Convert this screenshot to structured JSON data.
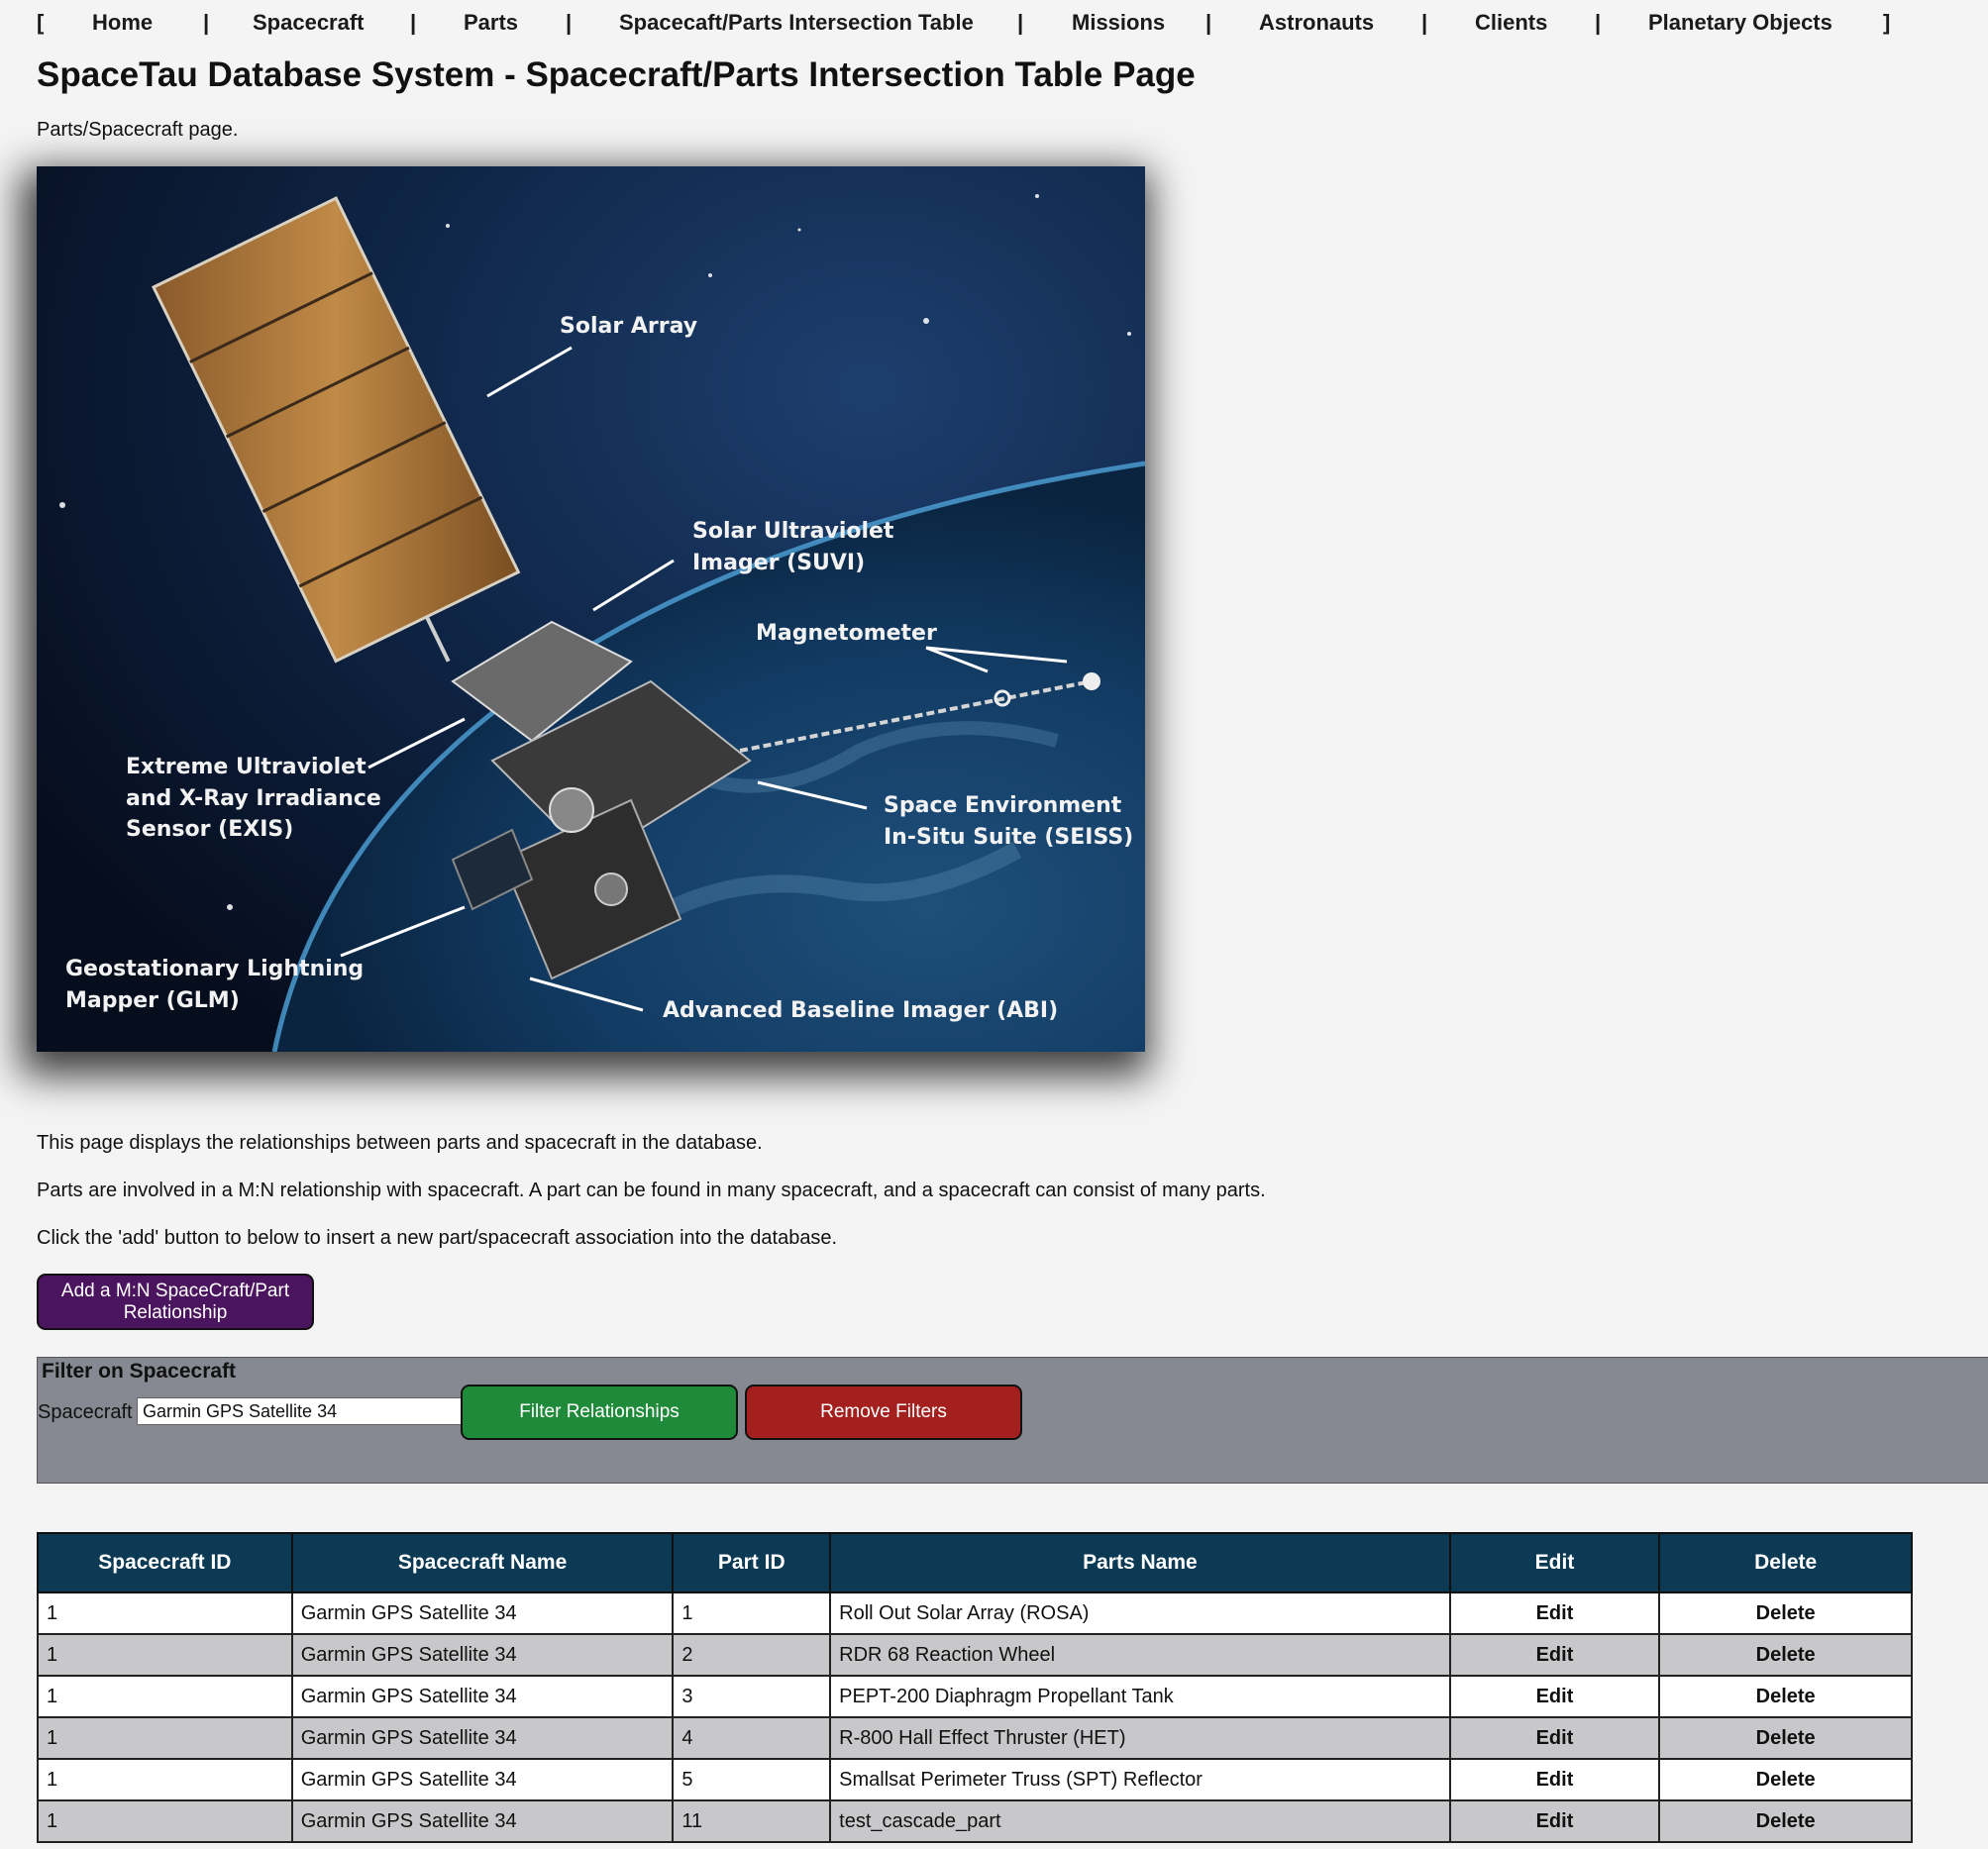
{
  "nav": {
    "bracket_open": "[",
    "bracket_close": "]",
    "separator": "|",
    "links": [
      "Home",
      "Spacecraft",
      "Parts",
      "Spacecaft/Parts Intersection Table",
      "Missions",
      "Astronauts",
      "Clients",
      "Planetary Objects"
    ]
  },
  "page": {
    "title": "SpaceTau Database System - Spacecraft/Parts Intersection Table Page",
    "subtitle": "Parts/Spacecraft page.",
    "para1": "This page displays the relationships between parts and spacecraft in the database.",
    "para2": "Parts are involved in a M:N relationship with spacecraft. A part can be found in many spacecraft, and a spacecraft can consist of many parts.",
    "para3": "Click the 'add' button to below to insert a new part/spacecraft association into the database."
  },
  "image": {
    "labels": {
      "solar_array": "Solar Array",
      "suvi_1": "Solar Ultraviolet",
      "suvi_2": "Imager  (SUVI)",
      "magnetometer": "Magnetometer",
      "exis_1": "Extreme Ultraviolet",
      "exis_2": "and X-Ray Irradiance",
      "exis_3": "Sensor (EXIS)",
      "seiss_1": "Space Environment",
      "seiss_2": "In-Situ Suite  (SEISS)",
      "glm_1": "Geostationary Lightning",
      "glm_2": "Mapper (GLM)",
      "abi": "Advanced Baseline Imager (ABI)"
    }
  },
  "add_button": "Add a M:N SpaceCraft/Part Relationship",
  "filter": {
    "legend": "Filter on Spacecraft",
    "label": "Spacecraft",
    "selected": "Garmin GPS Satellite 34",
    "filter_button": "Filter Relationships",
    "remove_button": "Remove Filters"
  },
  "table": {
    "headers": [
      "Spacecraft ID",
      "Spacecraft Name",
      "Part ID",
      "Parts Name",
      "Edit",
      "Delete"
    ],
    "rows": [
      {
        "sc_id": "1",
        "sc_name": "Garmin GPS Satellite 34",
        "part_id": "1",
        "part_name": "Roll Out Solar Array (ROSA)",
        "edit": "Edit",
        "delete": "Delete"
      },
      {
        "sc_id": "1",
        "sc_name": "Garmin GPS Satellite 34",
        "part_id": "2",
        "part_name": "RDR 68 Reaction Wheel",
        "edit": "Edit",
        "delete": "Delete"
      },
      {
        "sc_id": "1",
        "sc_name": "Garmin GPS Satellite 34",
        "part_id": "3",
        "part_name": "PEPT-200 Diaphragm Propellant Tank",
        "edit": "Edit",
        "delete": "Delete"
      },
      {
        "sc_id": "1",
        "sc_name": "Garmin GPS Satellite 34",
        "part_id": "4",
        "part_name": "R-800 Hall Effect Thruster (HET)",
        "edit": "Edit",
        "delete": "Delete"
      },
      {
        "sc_id": "1",
        "sc_name": "Garmin GPS Satellite 34",
        "part_id": "5",
        "part_name": "Smallsat Perimeter Truss (SPT) Reflector",
        "edit": "Edit",
        "delete": "Delete"
      },
      {
        "sc_id": "1",
        "sc_name": "Garmin GPS Satellite 34",
        "part_id": "11",
        "part_name": "test_cascade_part",
        "edit": "Edit",
        "delete": "Delete"
      }
    ]
  }
}
